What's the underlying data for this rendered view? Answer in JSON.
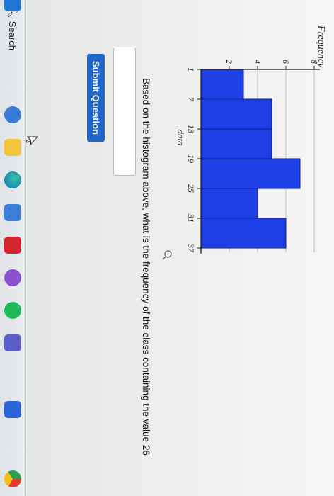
{
  "question": {
    "text": "Based on the histogram above, what is the frequency of the class containing the value 26",
    "answer_value": "",
    "submit_label": "Submit Question"
  },
  "taskbar": {
    "search_label": "Search",
    "apps": [
      "windows-start-icon",
      "widget-icon",
      "file-explorer-icon",
      "edge-icon",
      "store-icon",
      "mcafee-icon",
      "app-icon",
      "spotify-icon",
      "teams-icon",
      "phone-link-icon",
      "chrome-icon"
    ]
  },
  "colors": {
    "bar_fill": "#1f3fe6",
    "bar_stroke": "#0c1c96",
    "button": "#2266c8"
  },
  "chart_data": {
    "type": "bar",
    "title": "",
    "xlabel": "data",
    "ylabel": "Frequency",
    "x_ticks": [
      1,
      7,
      13,
      19,
      25,
      31,
      37
    ],
    "y_ticks": [
      2,
      4,
      6,
      8
    ],
    "ylim": [
      0,
      8
    ],
    "bins": [
      [
        1,
        7
      ],
      [
        7,
        13
      ],
      [
        13,
        19
      ],
      [
        19,
        25
      ],
      [
        25,
        31
      ],
      [
        31,
        37
      ]
    ],
    "values": [
      3,
      5,
      5,
      7,
      4,
      6
    ],
    "grid": true,
    "legend": "none"
  }
}
